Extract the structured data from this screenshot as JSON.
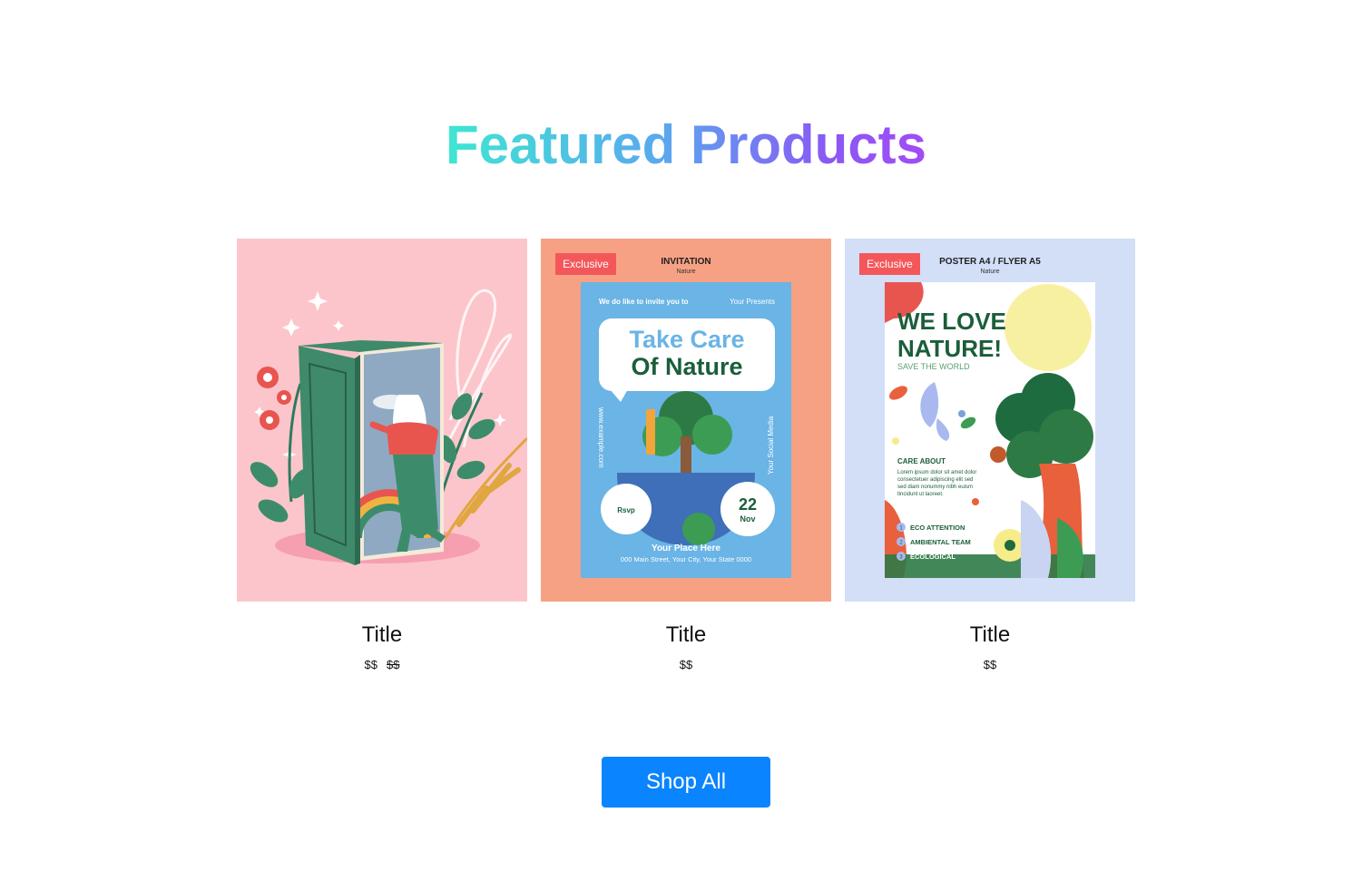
{
  "heading": "Featured Products",
  "products": [
    {
      "title": "Title",
      "price": "$$",
      "old_price": "$$",
      "bg": "#fcc5cb"
    },
    {
      "title": "Title",
      "price": "$$",
      "bg": "#f6a184",
      "badge": "Exclusive",
      "category": "INVITATION",
      "subcategory": "Nature",
      "flyer": {
        "invite": "We do like to invite you to",
        "presents": "Your Presents",
        "headline1": "Take Care",
        "headline2": "Of Nature",
        "website": "www.example.com",
        "social": "Your Social Media",
        "rsvp": "Rsvp",
        "day": "22",
        "month": "Nov",
        "place": "Your Place Here",
        "address": "000 Main Street, Your City, Your State 0000"
      }
    },
    {
      "title": "Title",
      "price": "$$",
      "bg": "#d3def7",
      "badge": "Exclusive",
      "category": "POSTER A4 / FLYER A5",
      "subcategory": "Nature",
      "poster": {
        "headline1": "WE LOVE",
        "headline2": "NATURE!",
        "tagline": "SAVE THE WORLD",
        "care": "CARE ABOUT",
        "lorem": [
          "Lorem ipsum dolor sit amet dolor",
          "consectetuer adipiscing elit sed",
          "sed diam nonummy nibh euism",
          "tincidunt ut laoreet."
        ],
        "items": [
          {
            "n": "1",
            "label": "ECO ATTENTION"
          },
          {
            "n": "2",
            "label": "AMBIENTAL TEAM"
          },
          {
            "n": "3",
            "label": "ECOLOGICAL"
          }
        ]
      }
    }
  ],
  "shop_all": "Shop All",
  "colors": {
    "accent": "#0a84ff",
    "badge": "#f4575a",
    "heading_gradient": [
      "#3ee6d2",
      "#8a58f5"
    ]
  }
}
